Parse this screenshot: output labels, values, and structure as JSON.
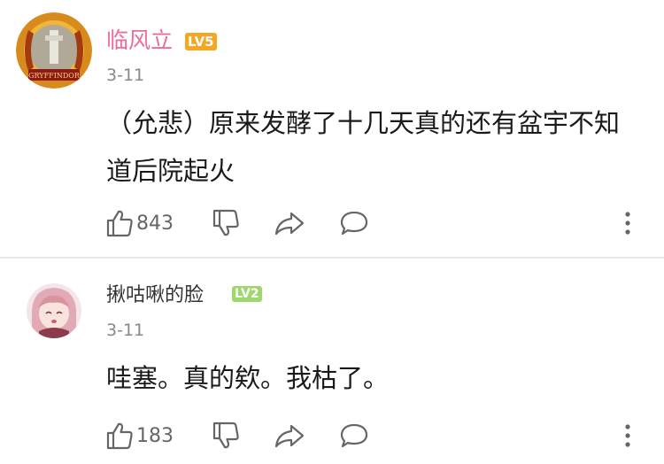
{
  "comments": [
    {
      "username": "临风立",
      "level": "LV5",
      "date": "3-11",
      "text_line1": "（允悲）原来发酵了十几天真的还有盆宇不知",
      "text_line2": "道后院起火",
      "likes": "843",
      "avatar_text": "GRYFFINDOR",
      "level_color": "#f5a623",
      "name_color": "#f06a9b"
    },
    {
      "username": "揪咕啾的脸",
      "level": "LV2",
      "date": "3-11",
      "text_line1": "哇塞。真的欸。我枯了。",
      "likes": "183",
      "level_color": "#9ed86a",
      "name_color": "#333333"
    }
  ],
  "icons": {
    "like": "thumbs-up-icon",
    "dislike": "thumbs-down-icon",
    "share": "share-icon",
    "reply": "comment-bubble-icon",
    "more": "more-vertical-icon"
  }
}
